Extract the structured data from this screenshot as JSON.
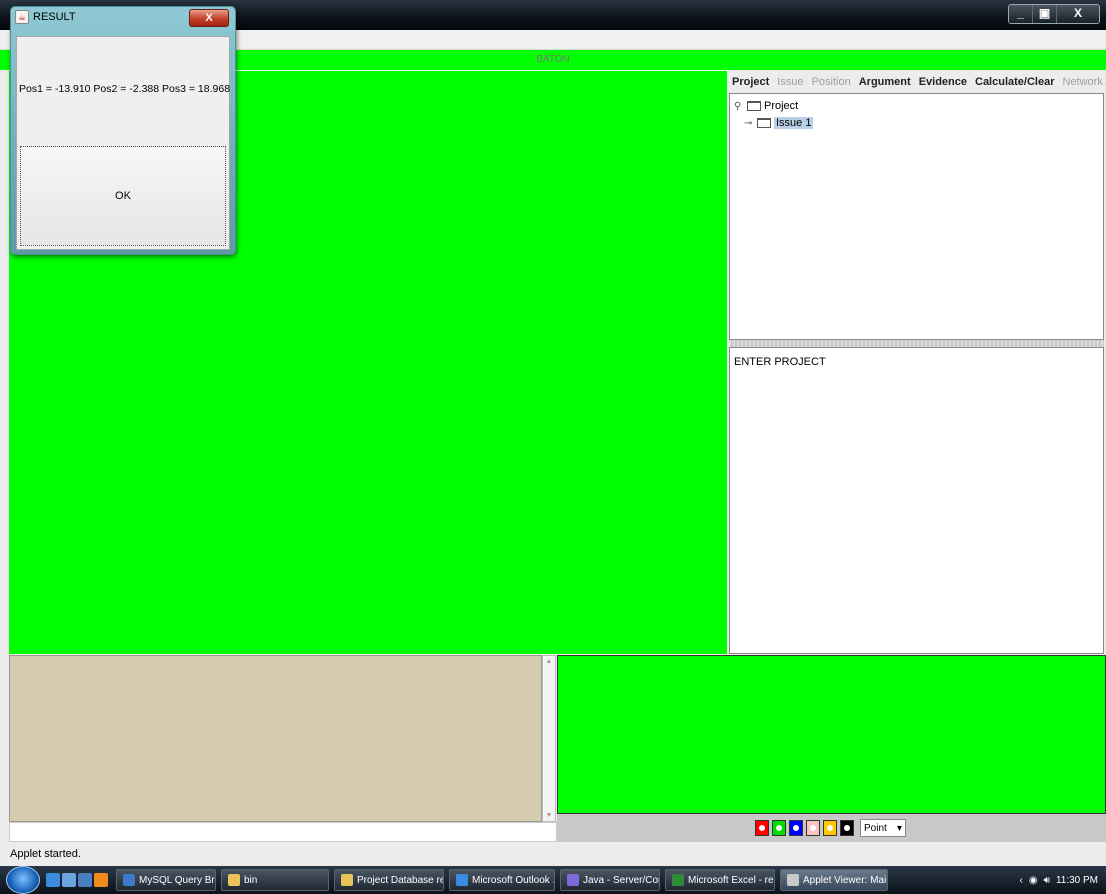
{
  "window": {
    "controls": [
      "_",
      "▣",
      "X"
    ]
  },
  "baton_bar": {
    "label": "BATON"
  },
  "toolbar": {
    "items": [
      {
        "label": "Project",
        "enabled": true
      },
      {
        "label": "Issue",
        "enabled": false
      },
      {
        "label": "Position",
        "enabled": false
      },
      {
        "label": "Argument",
        "enabled": true
      },
      {
        "label": "Evidence",
        "enabled": true
      },
      {
        "label": "Calculate/Clear",
        "enabled": true
      },
      {
        "label": "Network Analysis",
        "enabled": false
      }
    ]
  },
  "tree": {
    "root": "Project",
    "child": "Issue 1"
  },
  "entry_panel": {
    "text": "ENTER PROJECT"
  },
  "palette": {
    "colors": [
      "#ff0000",
      "#00dd00",
      "#0000ff",
      "#ffc0c0",
      "#ffc800",
      "#000000"
    ],
    "shape_selected": "Point"
  },
  "status": {
    "applet": "Applet started."
  },
  "taskbar": {
    "tasks": [
      {
        "label": "MySQL Query Brow...",
        "icon_color": "#3d7bc8"
      },
      {
        "label": "bin",
        "icon_color": "#e8c35a"
      },
      {
        "label": "Project Database rec...",
        "icon_color": "#e8c35a"
      },
      {
        "label": "Microsoft Outlook ...",
        "icon_color": "#3b8be0"
      },
      {
        "label": "Java - Server/Confi...",
        "icon_color": "#7c6bd6"
      },
      {
        "label": "Microsoft Excel - res...",
        "icon_color": "#2e8b3a"
      },
      {
        "label": "Applet Viewer: Main...",
        "icon_color": "#c9c9c9"
      }
    ],
    "clock": "11:30 PM"
  },
  "dialog": {
    "title": "RESULT",
    "close": "X",
    "message": "Pos1 = -13.910  Pos2 = -2.388  Pos3 = 18.968",
    "ok_label": "OK"
  }
}
